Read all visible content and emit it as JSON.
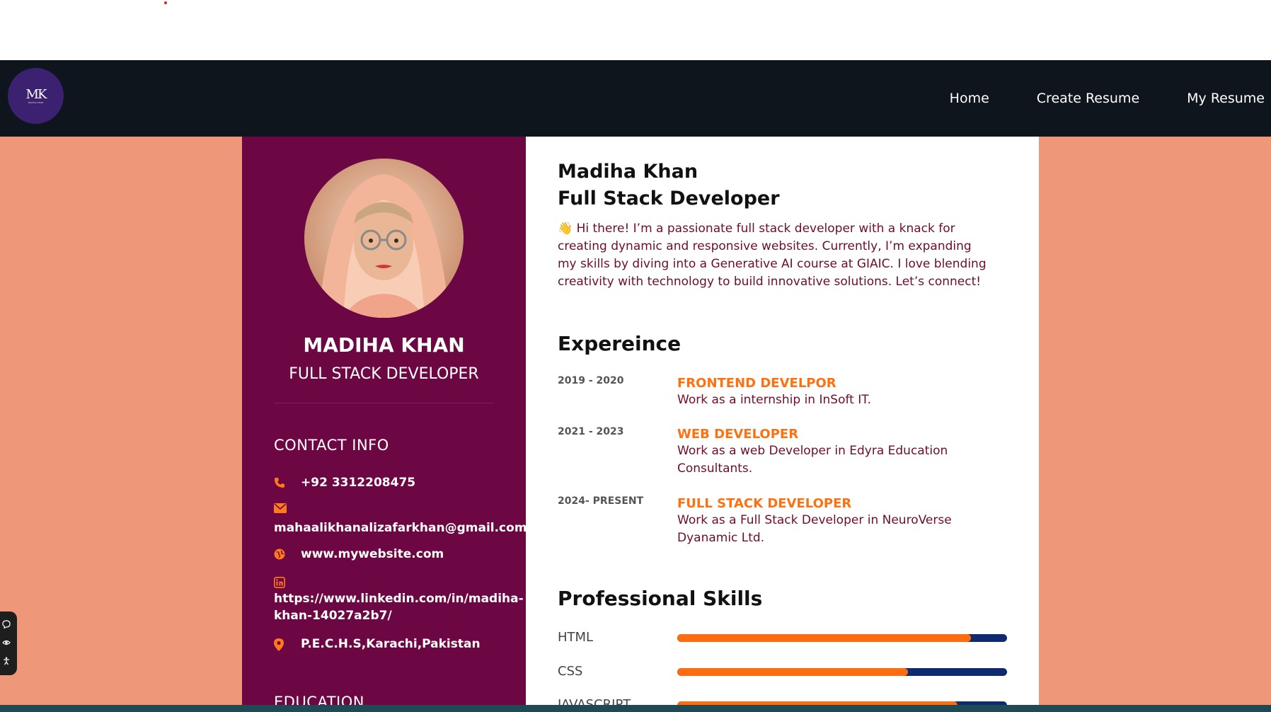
{
  "nav": {
    "logo_text": "MK",
    "logo_sub": "MADIHA KHAN",
    "links": [
      "Home",
      "Create Resume",
      "My Resume"
    ]
  },
  "sidebar": {
    "name": "MADIHA KHAN",
    "role": "FULL STACK DEVELOPER",
    "contact_heading": "CONTACT INFO",
    "phone": "+92 3312208475",
    "email": "mahaalikhanalizafarkhan@gmail.com",
    "website": "www.mywebsite.com",
    "linkedin_line1": "https://www.linkedin.com/in/madiha-",
    "linkedin_line2": "khan-14027a2b7/",
    "address": "P.E.C.H.S,Karachi,Pakistan",
    "education_heading": "EDUCATION"
  },
  "main": {
    "name": "Madiha Khan",
    "role": "Full Stack Developer",
    "bio": "👋 Hi there! I’m a passionate full stack developer with a knack for creating dynamic and responsive websites. Currently, I’m expanding my skills by diving into a Generative AI course at GIAIC. I love blending creativity with technology to build innovative solutions. Let’s connect!",
    "experience_heading": "Expereince",
    "experience": [
      {
        "date": "2019 - 2020",
        "title": "FRONTEND DEVELPOR",
        "desc": "Work as a internship in InSoft IT."
      },
      {
        "date": "2021 - 2023",
        "title": "WEB DEVELOPER",
        "desc": "Work as a web Developer in Edyra Education Consultants."
      },
      {
        "date": "2024- PRESENT",
        "title": "FULL STACK DEVELOPER",
        "desc": "Work as a Full Stack Developer in NeuroVerse Dyanamic Ltd."
      }
    ],
    "skills_heading": "Professional Skills",
    "skills": [
      {
        "name": "HTML",
        "level": 0.89
      },
      {
        "name": "CSS",
        "level": 0.7
      },
      {
        "name": "JAVASCRIPT",
        "level": 0.85
      }
    ]
  },
  "colors": {
    "nav_bg": "#0e151c",
    "page_bg": "#ee9779",
    "sidebar_bg": "#6c0744",
    "accent": "#ff6b0f",
    "skill_track": "#0f2a6e"
  },
  "icons": [
    "phone-icon",
    "envelope-icon",
    "globe-icon",
    "linkedin-icon",
    "map-pin-icon",
    "chat-icon",
    "eye-icon",
    "accessibility-icon"
  ]
}
